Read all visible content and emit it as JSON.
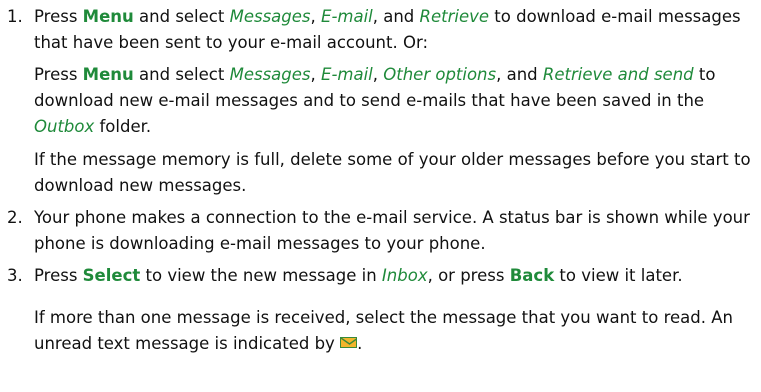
{
  "steps": [
    {
      "number": "1.",
      "paragraphs": [
        {
          "p1": "Press ",
          "menu": "Menu",
          "p2": " and select ",
          "messages": "Messages",
          "p3": ", ",
          "email": "E-mail",
          "p4": ", and ",
          "retrieve": "Retrieve",
          "p5": " to download e-mail messages that have been sent to your e-mail account. Or:"
        },
        {
          "p1": "Press ",
          "menu": "Menu",
          "p2": " and select ",
          "messages": "Messages",
          "p3": ", ",
          "email": "E-mail",
          "p4": ", ",
          "other_options": "Other options",
          "p5": ", and ",
          "retrieve_and_send": "Retrieve and send",
          "p6": " to download new e-mail messages and to send e-mails that have been saved in the ",
          "outbox": "Outbox",
          "p7": " folder."
        },
        {
          "text": "If the message memory is full, delete some of your older messages before you start to download new messages."
        }
      ]
    },
    {
      "number": "2.",
      "paragraphs": [
        {
          "text": "Your phone makes a connection to the e-mail service. A status bar is shown while your phone is downloading e-mail messages to your phone."
        }
      ]
    },
    {
      "number": "3.",
      "paragraphs": [
        {
          "p1": "Press ",
          "select": "Select",
          "p2": " to view the new message in ",
          "inbox": "Inbox",
          "p3": ", or press ",
          "back": "Back",
          "p4": " to view it later."
        },
        {
          "p1": "If more than one message is received, select the message that you want to read. An unread text message is indicated by ",
          "icon": "unread-message-envelope-icon",
          "p2": "."
        }
      ]
    }
  ],
  "colors": {
    "accent": "#1f8a3a",
    "text": "#111111",
    "envelope": "#f2b52c"
  }
}
